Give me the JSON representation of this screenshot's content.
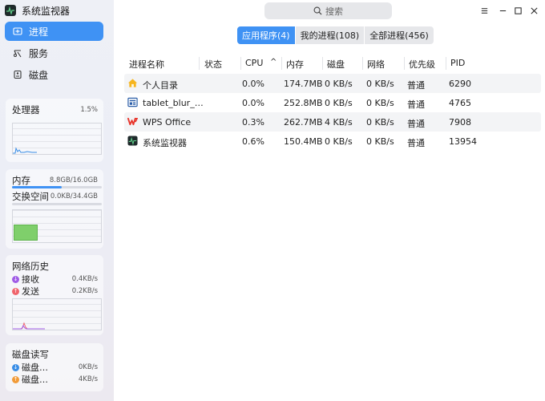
{
  "app": {
    "title": "系统监视器"
  },
  "sidebar": {
    "nav": [
      {
        "label": "进程",
        "icon": "process-icon",
        "active": true
      },
      {
        "label": "服务",
        "icon": "service-icon",
        "active": false
      },
      {
        "label": "磁盘",
        "icon": "disk-icon",
        "active": false
      }
    ],
    "cpu": {
      "title": "处理器",
      "value": "1.5%"
    },
    "memory": {
      "title": "内存",
      "value": "8.8GB/16.0GB",
      "used_fraction": 0.55,
      "swap_title": "交换空间",
      "swap_value": "0.0KB/34.4GB"
    },
    "network": {
      "title": "网络历史",
      "recv_label": "接收",
      "recv_value": "0.4KB/s",
      "send_label": "发送",
      "send_value": "0.2KB/s"
    },
    "diskio": {
      "title": "磁盘读写",
      "read_label": "磁盘…",
      "read_value": "0KB/s",
      "write_label": "磁盘…",
      "write_value": "4KB/s"
    }
  },
  "search": {
    "placeholder": "搜索"
  },
  "tabs": [
    {
      "label": "应用程序(4)",
      "active": true
    },
    {
      "label": "我的进程(108)",
      "active": false
    },
    {
      "label": "全部进程(456)",
      "active": false
    }
  ],
  "columns": [
    "进程名称",
    "状态",
    "CPU",
    "内存",
    "磁盘",
    "网络",
    "优先级",
    "PID"
  ],
  "rows": [
    {
      "name": "个人目录",
      "icon": "home-folder-icon",
      "status": "",
      "cpu": "0.0%",
      "mem": "174.7MB",
      "disk": "0 KB/s",
      "net": "0 KB/s",
      "priority": "普通",
      "pid": "6290"
    },
    {
      "name": "tablet_blur_…",
      "icon": "tablet-app-icon",
      "status": "",
      "cpu": "0.0%",
      "mem": "252.8MB",
      "disk": "0 KB/s",
      "net": "0 KB/s",
      "priority": "普通",
      "pid": "4765"
    },
    {
      "name": "WPS Office",
      "icon": "wps-office-icon",
      "status": "",
      "cpu": "0.3%",
      "mem": "262.7MB",
      "disk": "4 KB/s",
      "net": "0 KB/s",
      "priority": "普通",
      "pid": "7908"
    },
    {
      "name": "系统监视器",
      "icon": "system-monitor-icon",
      "status": "",
      "cpu": "0.6%",
      "mem": "150.4MB",
      "disk": "0 KB/s",
      "net": "0 KB/s",
      "priority": "普通",
      "pid": "13954"
    }
  ],
  "colors": {
    "accent": "#3f92f4",
    "recv": "#a05ce6",
    "send": "#f0646c",
    "read": "#3a8ee6",
    "write": "#f29b38",
    "swap_fill": "#7fcf6b"
  }
}
